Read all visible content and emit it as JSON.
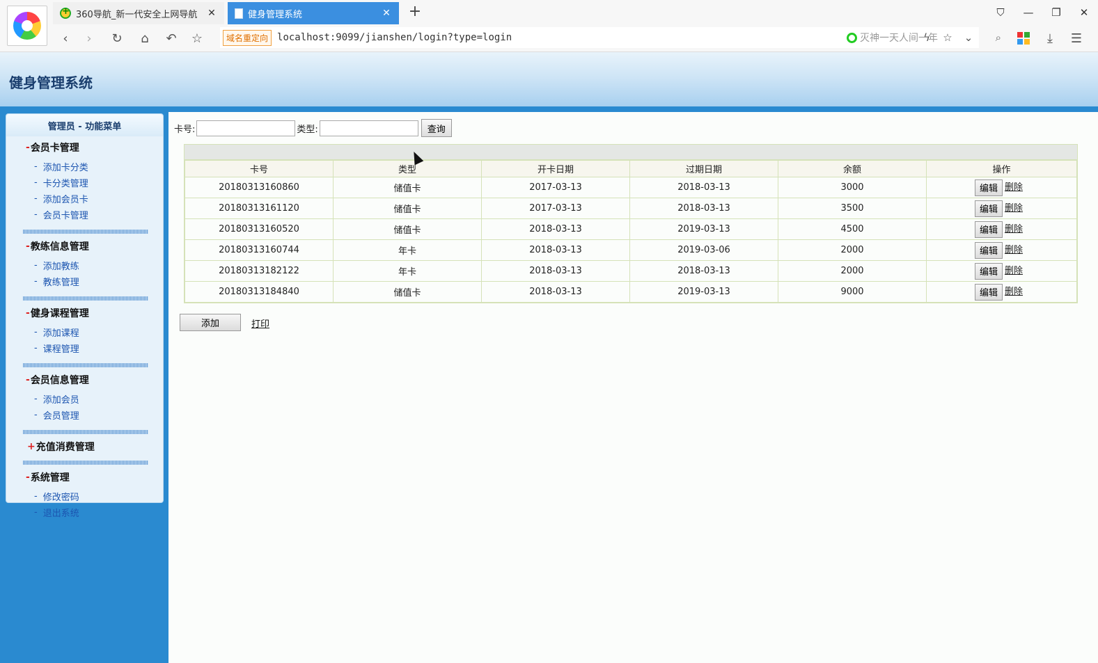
{
  "browser": {
    "tabs": [
      {
        "title": "360导航_新一代安全上网导航",
        "active": false
      },
      {
        "title": "健身管理系统",
        "active": true
      }
    ],
    "redirect_badge": "域名重定向",
    "url": "localhost:9099/jianshen/login?type=login",
    "search_placeholder": "灭神一天人间一年"
  },
  "header": {
    "site_title": "健身管理系统"
  },
  "sidebar": {
    "title": "管理员 - 功能菜单",
    "groups": [
      {
        "sign": "-",
        "title": "会员卡管理",
        "items": [
          "添加卡分类",
          "卡分类管理",
          "添加会员卡",
          "会员卡管理"
        ]
      },
      {
        "sign": "-",
        "title": "教练信息管理",
        "items": [
          "添加教练",
          "教练管理"
        ]
      },
      {
        "sign": "-",
        "title": "健身课程管理",
        "items": [
          "添加课程",
          "课程管理"
        ]
      },
      {
        "sign": "-",
        "title": "会员信息管理",
        "items": [
          "添加会员",
          "会员管理"
        ]
      },
      {
        "sign": "+",
        "title": "充值消费管理",
        "items": []
      },
      {
        "sign": "-",
        "title": "系统管理",
        "items": [
          "修改密码",
          "退出系统"
        ]
      }
    ]
  },
  "filter": {
    "card_label": "卡号:",
    "card_value": "",
    "type_label": "类型:",
    "type_value": "",
    "query_label": "查询"
  },
  "table": {
    "headers": [
      "卡号",
      "类型",
      "开卡日期",
      "过期日期",
      "余额",
      "操作"
    ],
    "rows": [
      [
        "20180313160860",
        "储值卡",
        "2017-03-13",
        "2018-03-13",
        "3000"
      ],
      [
        "20180313161120",
        "储值卡",
        "2017-03-13",
        "2018-03-13",
        "3500"
      ],
      [
        "20180313160520",
        "储值卡",
        "2018-03-13",
        "2019-03-13",
        "4500"
      ],
      [
        "20180313160744",
        "年卡",
        "2018-03-13",
        "2019-03-06",
        "2000"
      ],
      [
        "20180313182122",
        "年卡",
        "2018-03-13",
        "2018-03-13",
        "2000"
      ],
      [
        "20180313184840",
        "储值卡",
        "2018-03-13",
        "2019-03-13",
        "9000"
      ]
    ],
    "edit_label": "编辑",
    "delete_label": "删除"
  },
  "actions": {
    "add_label": "添加",
    "print_label": "打印"
  }
}
